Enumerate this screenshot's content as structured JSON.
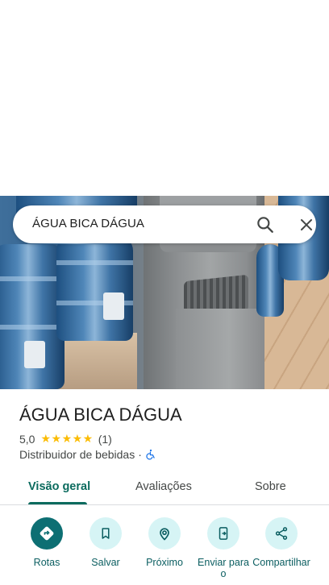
{
  "search": {
    "query": "ÁGUA BICA DÁGUA"
  },
  "place": {
    "name": "ÁGUA BICA DÁGUA",
    "rating": "5,0",
    "stars": "★★★★★",
    "review_count": "(1)",
    "category": "Distribuidor de bebidas",
    "separator": "·"
  },
  "tabs": [
    {
      "label": "Visão geral",
      "active": true
    },
    {
      "label": "Avaliações",
      "active": false
    },
    {
      "label": "Sobre",
      "active": false
    }
  ],
  "actions": [
    {
      "label": "Rotas",
      "icon": "directions-icon"
    },
    {
      "label": "Salvar",
      "icon": "bookmark-icon"
    },
    {
      "label": "Próximo",
      "icon": "nearby-icon"
    },
    {
      "label": "Enviar para o",
      "icon": "send-to-phone-icon"
    },
    {
      "label": "Compartilhar",
      "icon": "share-icon"
    }
  ],
  "colors": {
    "accent": "#0b6b5e",
    "action_bg": "#d6f4f5",
    "primary_action": "#0d6f73",
    "star": "#fbbc04"
  }
}
